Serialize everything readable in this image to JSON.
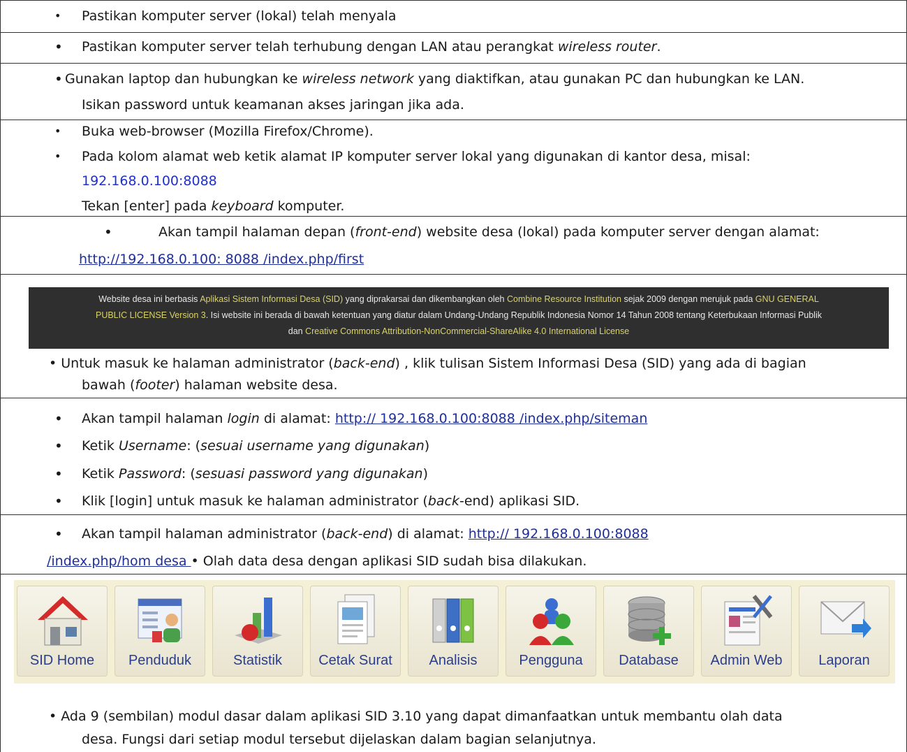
{
  "steps": {
    "s1": "Pastikan komputer server (lokal) telah menyala",
    "s2_a": "Pastikan komputer server telah terhubung dengan LAN atau perangkat ",
    "s2_b": "wireless router",
    "s2_c": ".",
    "s3_a": "Gunakan laptop dan hubungkan ke ",
    "s3_b": "wireless network",
    "s3_c": " yang diaktifkan, atau gunakan PC dan hubungkan ke LAN.",
    "s3_d": "Isikan password untuk keamanan akses jaringan jika ada.",
    "s4_a": "Buka web-browser (Mozilla Firefox/Chrome).",
    "s4_b": "Pada kolom alamat web ketik alamat IP komputer server lokal yang digunakan di kantor desa, misal:",
    "s4_ip": "192.168.0.100:8088",
    "s4_c1": "Tekan [enter] pada ",
    "s4_c2": "keyboard",
    "s4_c3": " komputer.",
    "s5_a": "Akan tampil halaman depan (",
    "s5_b": "front-end",
    "s5_c": ") website desa (lokal) pada komputer server dengan alamat:",
    "s5_link": " http://192.168.0.100:  8088 /index.php/first",
    "s6_a": "• Untuk masuk ke halaman administrator (",
    "s6_b": "back-end",
    "s6_c": ") , klik tulisan Sistem Informasi Desa (SID) yang ada di bagian",
    "s6_d": "bawah (",
    "s6_e": "footer",
    "s6_f": ")  halaman website desa.",
    "s7_a": "Akan tampil halaman ",
    "s7_b": "login",
    "s7_c": " di alamat: ",
    "s7_link": " http://  192.168.0.100:8088 /index.php/siteman",
    "s8_a": "Ketik ",
    "s8_b": "Username",
    "s8_c": ": (",
    "s8_d": "sesuai username yang digunakan",
    "s8_e": ")",
    "s9_a": "Ketik ",
    "s9_b": "Password",
    "s9_c": ": (",
    "s9_d": "sesuasi password yang digunakan",
    "s9_e": ")",
    "s10_a": "Klik [login] untuk masuk ke halaman administrator (",
    "s10_b": "back",
    "s10_c": "-end) aplikasi SID.",
    "s11_a": "Akan tampil halaman administrator (",
    "s11_b": "back-end",
    "s11_c": ") di alamat: ",
    "s11_link1": " http://  192.168.0.100:8088",
    "s11_link2": "/index.php/hom  desa ",
    "s11_d": "•           Olah data desa dengan aplikasi SID sudah bisa dilakukan.",
    "s12_a": "• Ada 9 (sembilan) modul dasar dalam aplikasi SID 3.10 yang dapat dimanfaatkan untuk membantu olah data",
    "s12_b": "desa. Fungsi dari setiap modul tersebut dijelaskan dalam bagian selanjutnya."
  },
  "footer_banner": {
    "l1_a": "Website desa ini berbasis ",
    "l1_b": "Aplikasi Sistem Informasi Desa (SID)",
    "l1_c": " yang diprakarsai dan dikembangkan oleh ",
    "l1_d": "Combine Resource Institution",
    "l1_e": " sejak 2009 dengan merujuk pada ",
    "l1_f": "GNU GENERAL",
    "l2_a": "PUBLIC LICENSE Version 3",
    "l2_b": ". Isi website ini berada di bawah ketentuan yang diatur dalam Undang-Undang Republik Indonesia Nomor 14 Tahun 2008 tentang Keterbukaan Informasi Publik",
    "l3_a": "dan ",
    "l3_b": "Creative Commons Attribution-NonCommercial-ShareAlike 4.0 International License"
  },
  "modules": [
    {
      "label": "SID Home",
      "icon": "house-icon"
    },
    {
      "label": "Penduduk",
      "icon": "resident-card-icon"
    },
    {
      "label": "Statistik",
      "icon": "statistics-chart-icon"
    },
    {
      "label": "Cetak Surat",
      "icon": "print-letter-icon"
    },
    {
      "label": "Analisis",
      "icon": "binders-icon"
    },
    {
      "label": "Pengguna",
      "icon": "users-icon"
    },
    {
      "label": "Database",
      "icon": "database-add-icon"
    },
    {
      "label": "Admin Web",
      "icon": "web-admin-icon"
    },
    {
      "label": "Laporan",
      "icon": "envelope-send-icon"
    }
  ]
}
